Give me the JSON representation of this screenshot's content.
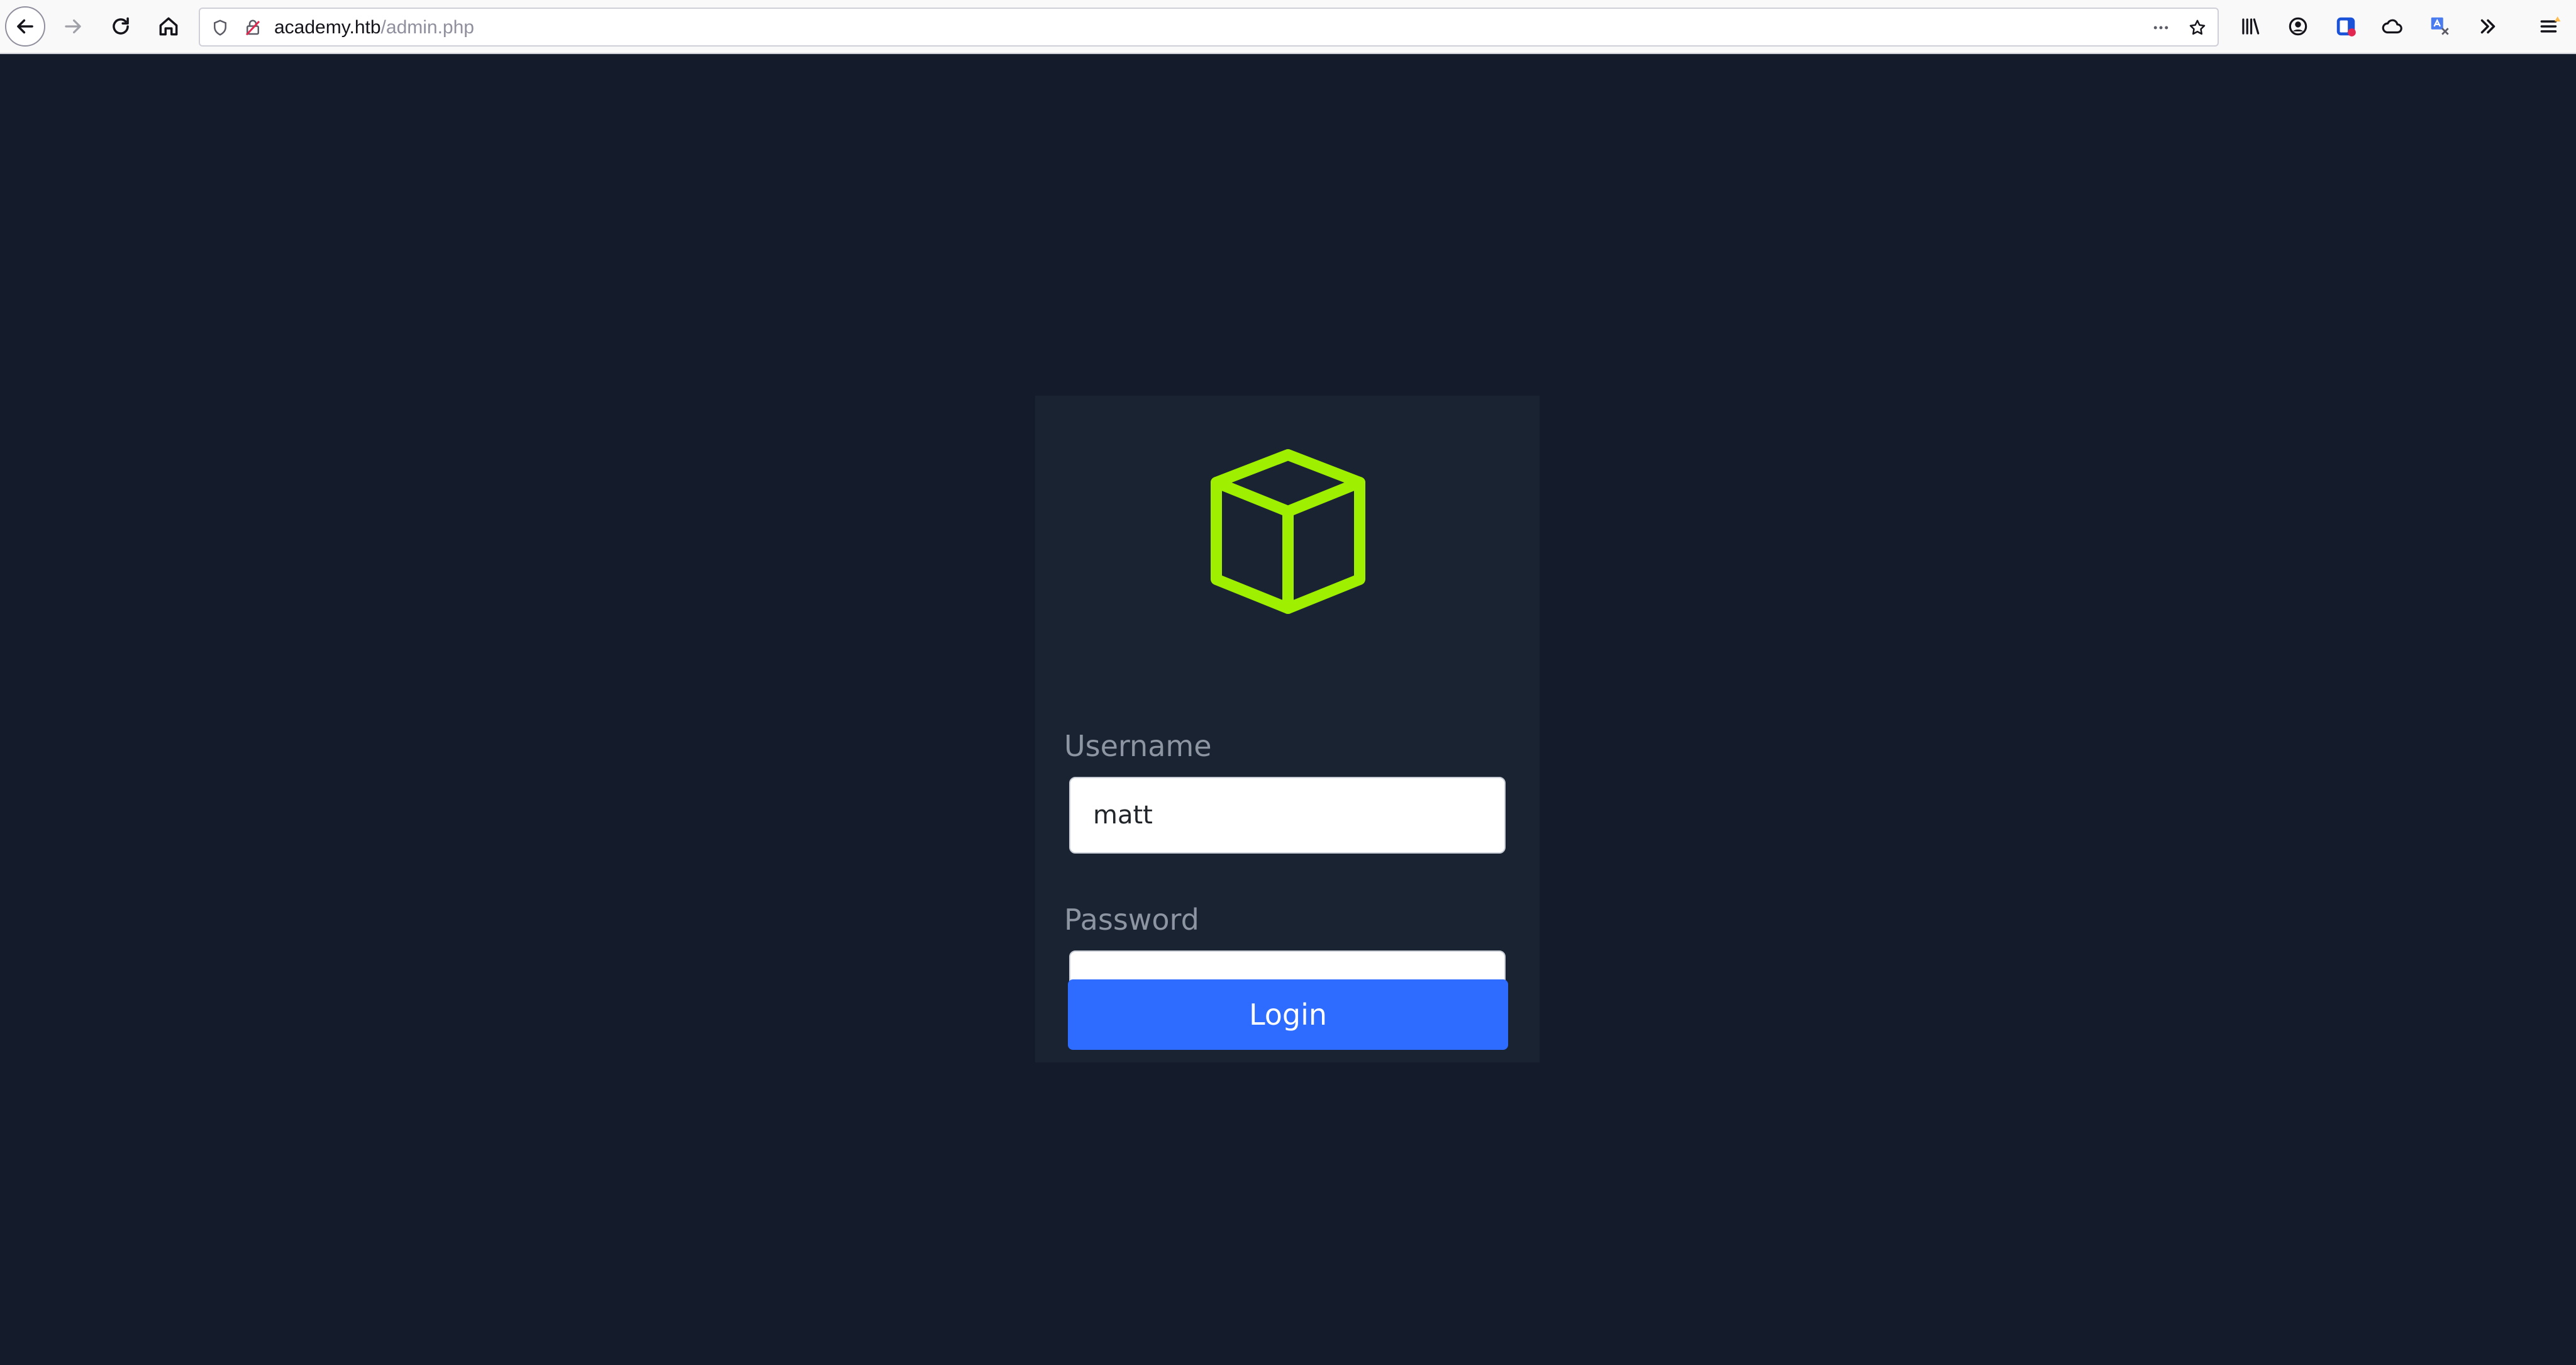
{
  "browser": {
    "url_host": "academy.htb",
    "url_path": "/admin.php",
    "buttons": {
      "back": "back-arrow-icon",
      "forward": "forward-arrow-icon",
      "reload": "reload-icon",
      "home": "home-icon",
      "page_actions": "more-horizontal-icon",
      "bookmark": "star-icon",
      "library": "library-icon",
      "account": "account-icon",
      "extension_1": "extension-icon",
      "sync": "cloud-icon",
      "translate": "translate-icon",
      "overflow": "double-chevron-right-icon",
      "menu": "hamburger-menu-icon"
    }
  },
  "login": {
    "username_label": "Username",
    "username_value": "matt",
    "password_label": "Password",
    "password_value": "••••••••••",
    "submit_label": "Login"
  },
  "colors": {
    "page_background": "#141c2b",
    "card_background": "#1a2332",
    "logo_accent": "#9fef00",
    "button_primary": "#2e6bff",
    "label_text": "#8d95a3"
  }
}
